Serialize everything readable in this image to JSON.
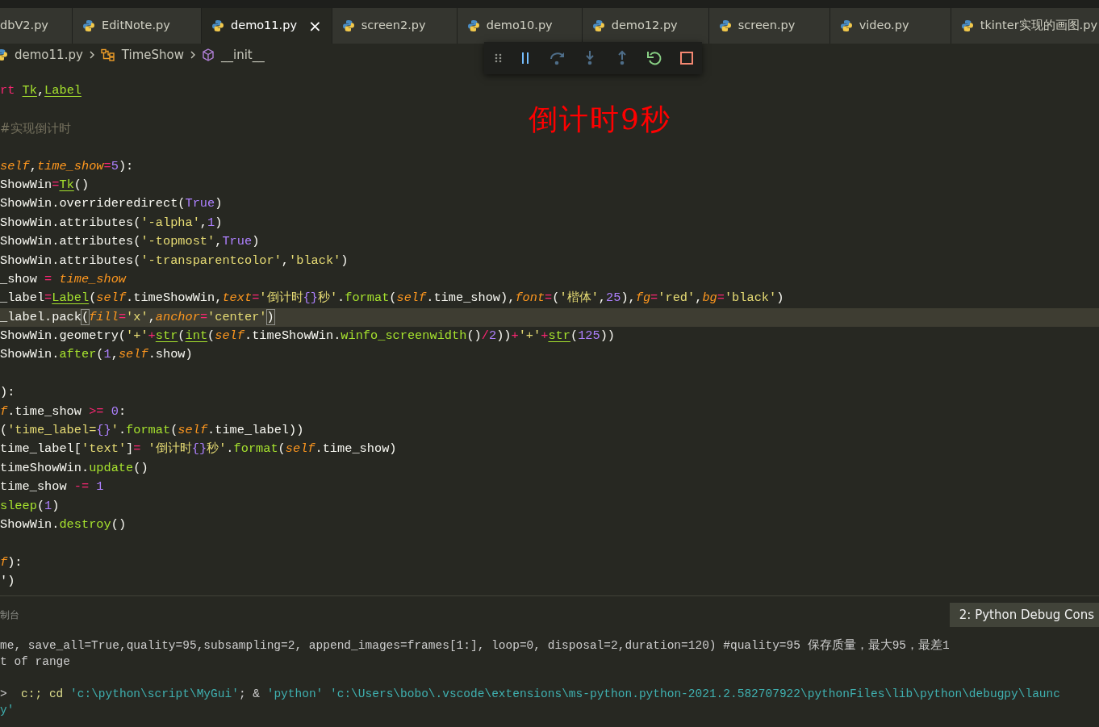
{
  "tabs": [
    {
      "label": "dbV2.py",
      "selected": false,
      "icon": false
    },
    {
      "label": "EditNote.py",
      "selected": false,
      "icon": true
    },
    {
      "label": "demo11.py",
      "selected": true,
      "icon": true,
      "close": "×"
    },
    {
      "label": "screen2.py",
      "selected": false,
      "icon": true
    },
    {
      "label": "demo10.py",
      "selected": false,
      "icon": true
    },
    {
      "label": "demo12.py",
      "selected": false,
      "icon": true
    },
    {
      "label": "screen.py",
      "selected": false,
      "icon": true
    },
    {
      "label": "video.py",
      "selected": false,
      "icon": true
    },
    {
      "label": "tkinter实现的画图.py",
      "selected": false,
      "icon": true
    }
  ],
  "breadcrumb": [
    {
      "kind": "file",
      "label": "demo11.py"
    },
    {
      "kind": "class",
      "label": "TimeShow"
    },
    {
      "kind": "method",
      "label": "__init__"
    }
  ],
  "overlay_text": "倒计时9秒",
  "code_lines": [
    {
      "tokens": [
        {
          "kind": "kw",
          "text": "rt "
        },
        {
          "kind": "cls",
          "text": "Tk"
        },
        {
          "kind": "plain",
          "text": ","
        },
        {
          "kind": "cls",
          "text": "Label"
        }
      ]
    },
    {
      "kind": "blank"
    },
    {
      "tokens": [
        {
          "kind": "cmt",
          "text": "#实现倒计时"
        }
      ]
    },
    {
      "kind": "blank"
    },
    {
      "tokens": [
        {
          "kind": "param",
          "text": "self"
        },
        {
          "kind": "plain",
          "text": ","
        },
        {
          "kind": "param",
          "text": "time_show"
        },
        {
          "kind": "op",
          "text": "="
        },
        {
          "kind": "num",
          "text": "5"
        },
        {
          "kind": "plain",
          "text": "):"
        }
      ]
    },
    {
      "tokens": [
        {
          "kind": "plain",
          "text": "ShowWin"
        },
        {
          "kind": "op",
          "text": "="
        },
        {
          "kind": "cls",
          "text": "Tk"
        },
        {
          "kind": "plain",
          "text": "()"
        }
      ]
    },
    {
      "tokens": [
        {
          "kind": "plain",
          "text": "ShowWin.overrideredirect("
        },
        {
          "kind": "num",
          "text": "True"
        },
        {
          "kind": "plain",
          "text": ")"
        }
      ]
    },
    {
      "tokens": [
        {
          "kind": "plain",
          "text": "ShowWin.attributes("
        },
        {
          "kind": "str",
          "text": "'-alpha'"
        },
        {
          "kind": "plain",
          "text": ","
        },
        {
          "kind": "num",
          "text": "1"
        },
        {
          "kind": "plain",
          "text": ")"
        }
      ]
    },
    {
      "tokens": [
        {
          "kind": "plain",
          "text": "ShowWin.attributes("
        },
        {
          "kind": "str",
          "text": "'-topmost'"
        },
        {
          "kind": "plain",
          "text": ","
        },
        {
          "kind": "num",
          "text": "True"
        },
        {
          "kind": "plain",
          "text": ")"
        }
      ]
    },
    {
      "tokens": [
        {
          "kind": "plain",
          "text": "ShowWin.attributes("
        },
        {
          "kind": "str",
          "text": "'-transparentcolor'"
        },
        {
          "kind": "plain",
          "text": ","
        },
        {
          "kind": "str",
          "text": "'black'"
        },
        {
          "kind": "plain",
          "text": ")"
        }
      ]
    },
    {
      "tokens": [
        {
          "kind": "plain",
          "text": "_show "
        },
        {
          "kind": "op",
          "text": "= "
        },
        {
          "kind": "param",
          "text": "time_show"
        }
      ]
    },
    {
      "tokens": [
        {
          "kind": "plain",
          "text": "_label"
        },
        {
          "kind": "op",
          "text": "="
        },
        {
          "kind": "cls",
          "text": "Label"
        },
        {
          "kind": "plain",
          "text": "("
        },
        {
          "kind": "param",
          "text": "self"
        },
        {
          "kind": "plain",
          "text": ".timeShowWin,"
        },
        {
          "kind": "param",
          "text": "text"
        },
        {
          "kind": "op",
          "text": "="
        },
        {
          "kind": "str",
          "text": "'倒计时"
        },
        {
          "kind": "num",
          "text": "{}"
        },
        {
          "kind": "str",
          "text": "秒'"
        },
        {
          "kind": "plain",
          "text": "."
        },
        {
          "kind": "fn",
          "text": "format"
        },
        {
          "kind": "plain",
          "text": "("
        },
        {
          "kind": "param",
          "text": "self"
        },
        {
          "kind": "plain",
          "text": ".time_show),"
        },
        {
          "kind": "param",
          "text": "font"
        },
        {
          "kind": "op",
          "text": "="
        },
        {
          "kind": "plain",
          "text": "("
        },
        {
          "kind": "str",
          "text": "'楷体'"
        },
        {
          "kind": "plain",
          "text": ","
        },
        {
          "kind": "num",
          "text": "25"
        },
        {
          "kind": "plain",
          "text": "),"
        },
        {
          "kind": "param",
          "text": "fg"
        },
        {
          "kind": "op",
          "text": "="
        },
        {
          "kind": "str",
          "text": "'red'"
        },
        {
          "kind": "plain",
          "text": ","
        },
        {
          "kind": "param",
          "text": "bg"
        },
        {
          "kind": "op",
          "text": "="
        },
        {
          "kind": "str",
          "text": "'black'"
        },
        {
          "kind": "plain",
          "text": ")"
        }
      ]
    },
    {
      "current": true,
      "tokens": [
        {
          "kind": "plain",
          "text": "_label.pack"
        },
        {
          "kind": "bracket",
          "text": "("
        },
        {
          "kind": "param",
          "text": "fill"
        },
        {
          "kind": "op",
          "text": "="
        },
        {
          "kind": "str",
          "text": "'x'"
        },
        {
          "kind": "plain",
          "text": ","
        },
        {
          "kind": "param",
          "text": "anchor"
        },
        {
          "kind": "op",
          "text": "="
        },
        {
          "kind": "str",
          "text": "'center'"
        },
        {
          "kind": "bracket",
          "text": ")"
        }
      ]
    },
    {
      "tokens": [
        {
          "kind": "plain",
          "text": "ShowWin.geometry("
        },
        {
          "kind": "str",
          "text": "'+'"
        },
        {
          "kind": "op",
          "text": "+"
        },
        {
          "kind": "cls",
          "text": "str"
        },
        {
          "kind": "plain",
          "text": "("
        },
        {
          "kind": "cls",
          "text": "int"
        },
        {
          "kind": "plain",
          "text": "("
        },
        {
          "kind": "param",
          "text": "self"
        },
        {
          "kind": "plain",
          "text": ".timeShowWin."
        },
        {
          "kind": "fn",
          "text": "winfo_screenwidth"
        },
        {
          "kind": "plain",
          "text": "()"
        },
        {
          "kind": "op",
          "text": "/"
        },
        {
          "kind": "num",
          "text": "2"
        },
        {
          "kind": "plain",
          "text": "))"
        },
        {
          "kind": "op",
          "text": "+"
        },
        {
          "kind": "str",
          "text": "'+'"
        },
        {
          "kind": "op",
          "text": "+"
        },
        {
          "kind": "cls",
          "text": "str"
        },
        {
          "kind": "plain",
          "text": "("
        },
        {
          "kind": "num",
          "text": "125"
        },
        {
          "kind": "plain",
          "text": "))"
        }
      ]
    },
    {
      "tokens": [
        {
          "kind": "plain",
          "text": "ShowWin."
        },
        {
          "kind": "fn",
          "text": "after"
        },
        {
          "kind": "plain",
          "text": "("
        },
        {
          "kind": "num",
          "text": "1"
        },
        {
          "kind": "plain",
          "text": ","
        },
        {
          "kind": "param",
          "text": "self"
        },
        {
          "kind": "plain",
          "text": ".show)"
        }
      ]
    },
    {
      "kind": "blank"
    },
    {
      "tokens": [
        {
          "kind": "plain",
          "text": "):"
        }
      ]
    },
    {
      "tokens": [
        {
          "kind": "param",
          "text": "f"
        },
        {
          "kind": "plain",
          "text": ".time_show "
        },
        {
          "kind": "op",
          "text": ">= "
        },
        {
          "kind": "num",
          "text": "0"
        },
        {
          "kind": "plain",
          "text": ":"
        }
      ]
    },
    {
      "tokens": [
        {
          "kind": "plain",
          "text": "("
        },
        {
          "kind": "str",
          "text": "'time_label="
        },
        {
          "kind": "num",
          "text": "{}"
        },
        {
          "kind": "str",
          "text": "'"
        },
        {
          "kind": "plain",
          "text": "."
        },
        {
          "kind": "fn",
          "text": "format"
        },
        {
          "kind": "plain",
          "text": "("
        },
        {
          "kind": "param",
          "text": "self"
        },
        {
          "kind": "plain",
          "text": ".time_label))"
        }
      ]
    },
    {
      "tokens": [
        {
          "kind": "plain",
          "text": "time_label["
        },
        {
          "kind": "str",
          "text": "'text'"
        },
        {
          "kind": "plain",
          "text": "]"
        },
        {
          "kind": "op",
          "text": "= "
        },
        {
          "kind": "str",
          "text": "'倒计时"
        },
        {
          "kind": "num",
          "text": "{}"
        },
        {
          "kind": "str",
          "text": "秒'"
        },
        {
          "kind": "plain",
          "text": "."
        },
        {
          "kind": "fn",
          "text": "format"
        },
        {
          "kind": "plain",
          "text": "("
        },
        {
          "kind": "param",
          "text": "self"
        },
        {
          "kind": "plain",
          "text": ".time_show)"
        }
      ]
    },
    {
      "tokens": [
        {
          "kind": "plain",
          "text": "timeShowWin."
        },
        {
          "kind": "fn",
          "text": "update"
        },
        {
          "kind": "plain",
          "text": "()"
        }
      ]
    },
    {
      "tokens": [
        {
          "kind": "plain",
          "text": "time_show "
        },
        {
          "kind": "op",
          "text": "-= "
        },
        {
          "kind": "num",
          "text": "1"
        }
      ]
    },
    {
      "tokens": [
        {
          "kind": "fn",
          "text": "sleep"
        },
        {
          "kind": "plain",
          "text": "("
        },
        {
          "kind": "num",
          "text": "1"
        },
        {
          "kind": "plain",
          "text": ")"
        }
      ]
    },
    {
      "tokens": [
        {
          "kind": "plain",
          "text": "ShowWin."
        },
        {
          "kind": "fn",
          "text": "destroy"
        },
        {
          "kind": "plain",
          "text": "()"
        }
      ]
    },
    {
      "kind": "blank"
    },
    {
      "tokens": [
        {
          "kind": "param",
          "text": "f"
        },
        {
          "kind": "plain",
          "text": "):"
        }
      ]
    },
    {
      "tokens": [
        {
          "kind": "plain",
          "text": "')"
        }
      ]
    }
  ],
  "panel": {
    "title": "制台",
    "selector": "2: Python Debug Cons"
  },
  "terminal_lines": [
    {
      "tokens": [
        {
          "kind": "plain",
          "text": "me, save_all=True,quality=95,subsampling=2, append_images=frames[1:], loop=0, disposal=2,duration=120) #quality=95 保存质量，最大95，最差1"
        }
      ]
    },
    {
      "tokens": [
        {
          "kind": "plain",
          "text": "t of range"
        }
      ]
    },
    {
      "kind": "blank"
    },
    {
      "tokens": [
        {
          "kind": "plain",
          "text": ">  "
        },
        {
          "kind": "cmd",
          "text": "c:; cd "
        },
        {
          "kind": "str",
          "text": "'c:\\python\\script\\MyGui'"
        },
        {
          "kind": "plain",
          "text": "; & "
        },
        {
          "kind": "str",
          "text": "'python'"
        },
        {
          "kind": "str",
          "text": " 'c:\\Users\\bobo\\.vscode\\extensions\\ms-python.python-2021.2.582707922\\pythonFiles\\lib\\python\\debugpy\\launc"
        }
      ]
    },
    {
      "tokens": [
        {
          "kind": "str",
          "text": "y'"
        }
      ]
    }
  ]
}
